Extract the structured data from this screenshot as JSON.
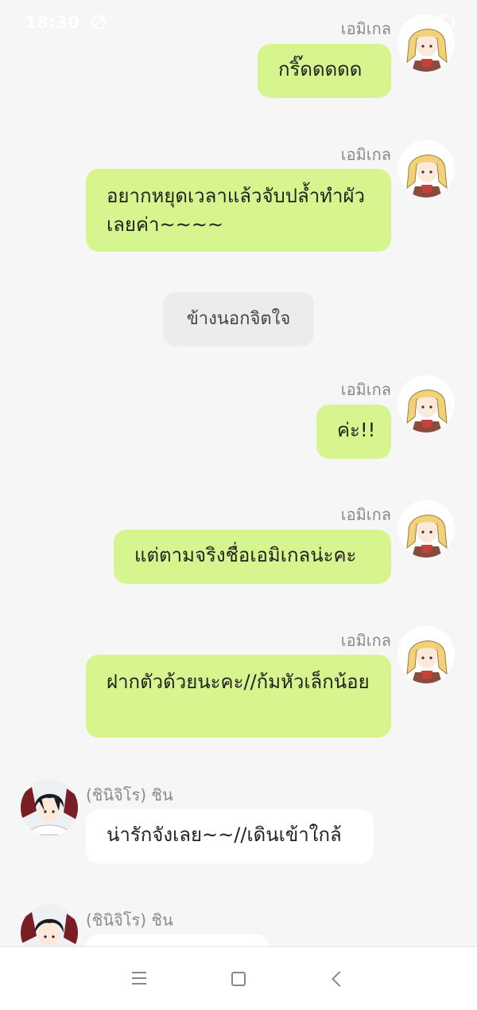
{
  "status_bar": {
    "time": "18:30"
  },
  "messages": [
    {
      "sender": "เอมิเกล",
      "text": "กริ๊ดดดดด"
    },
    {
      "sender": "เอมิเกล",
      "text": "อยากหยุดเวลาแล้วจับปล้ำทำผัวเลยค่า~~~~"
    },
    {
      "sender": "เอมิเกล",
      "text": "ค่ะ!!"
    },
    {
      "sender": "เอมิเกล",
      "text": "แต่ตามจริงชื่อเอมิเกลน่ะคะ"
    },
    {
      "sender": "เอมิเกล",
      "text": "ฝากตัวด้วยนะคะ//ก้มหัวเล็กน้อย"
    },
    {
      "sender": "(ชินิจิโร) ชิน",
      "text": "น่ารักจังเลย~~//เดินเข้าใกล้"
    },
    {
      "sender": "(ชินิจิโร) ชิน",
      "text": ""
    }
  ],
  "system_note": "ข้างนอกจิตใจ",
  "colors": {
    "bubble_self": "#d6f58f",
    "bubble_other": "#ffffff",
    "background": "#f6f6f6"
  },
  "icons": {
    "nav_menu": "menu-icon",
    "nav_home": "home-icon",
    "nav_back": "back-icon"
  }
}
